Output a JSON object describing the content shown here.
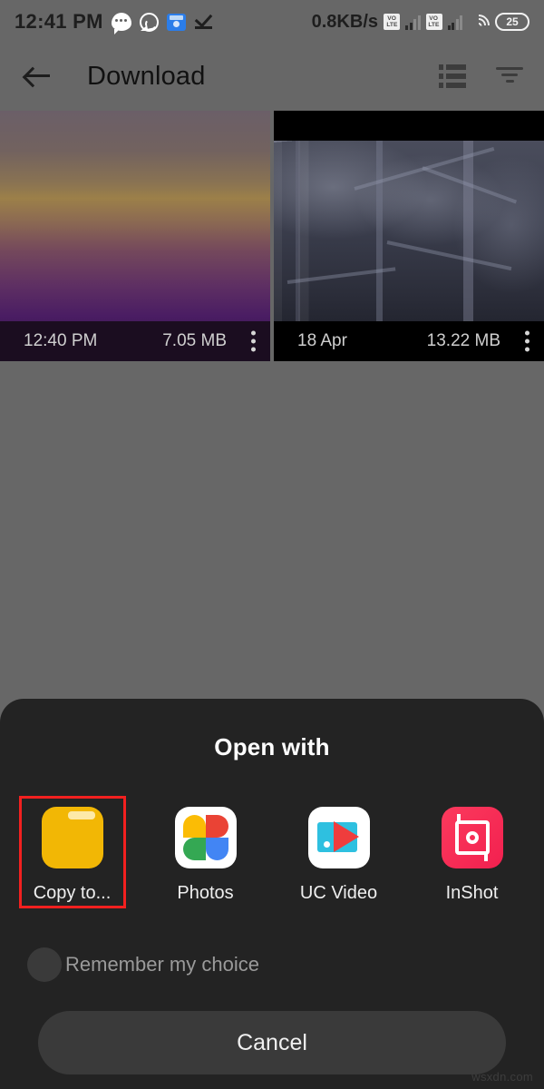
{
  "status_bar": {
    "clock": "12:41 PM",
    "network_speed": "0.8KB/s",
    "battery_level": "25",
    "volte_line1": "VO",
    "volte_line2": "LTE",
    "icons": [
      "chat-bubble-icon",
      "whatsapp-icon",
      "blue-file-icon",
      "check-icon",
      "volte-icon",
      "signal-bars-icon",
      "wifi-icon",
      "battery-icon"
    ]
  },
  "app_bar": {
    "title": "Download",
    "back_icon": "back-arrow-icon",
    "list_view_icon": "list-view-icon",
    "filter_icon": "filter-icon"
  },
  "grid": {
    "items": [
      {
        "time": "12:40 PM",
        "size": "7.05 MB",
        "kind": "sunset-photo",
        "menu_icon": "kebab-menu-icon"
      },
      {
        "time": "18 Apr",
        "size": "13.22 MB",
        "kind": "winter-forest-photo",
        "menu_icon": "kebab-menu-icon"
      }
    ]
  },
  "sheet": {
    "title": "Open with",
    "apps": [
      {
        "label": "Copy to...",
        "icon": "folder-icon",
        "selected": true
      },
      {
        "label": "Photos",
        "icon": "google-photos-icon",
        "selected": false
      },
      {
        "label": "UC Video",
        "icon": "uc-video-icon",
        "selected": false
      },
      {
        "label": "InShot",
        "icon": "inshot-icon",
        "selected": false
      }
    ],
    "remember_label": "Remember my choice",
    "remember_checked": false,
    "cancel_label": "Cancel"
  },
  "watermark": "wsxdn.com",
  "colors": {
    "backdrop": "#676767",
    "sheet": "#232323",
    "highlight": "#f2201f",
    "folder": "#f2b705",
    "inshot": "#f2204f"
  }
}
